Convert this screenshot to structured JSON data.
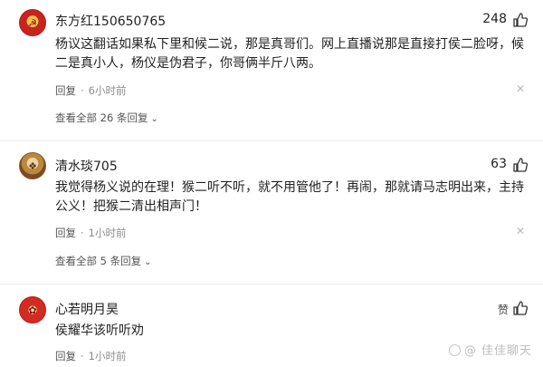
{
  "comments": [
    {
      "username": "东方红150650765",
      "likes": "248",
      "content": "杨议这翻话如果私下里和候二说，那是真哥们。网上直播说那是直接打侯二脸呀，候二是真小人，杨仪是伪君子，你哥俩半斤八两。",
      "reply_label": "回复",
      "time": "6小时前",
      "view_replies": "查看全部 26 条回复"
    },
    {
      "username": "清水琰705",
      "likes": "63",
      "content": "我觉得杨义说的在理！猴二听不听，就不用管他了！再闹，那就请马志明出来，主持公义！把猴二清出相声门！",
      "reply_label": "回复",
      "time": "1小时前",
      "view_replies": "查看全部 5 条回复"
    },
    {
      "username": "心若明月昊",
      "likes": "赞",
      "content": "侯耀华该听听劝",
      "reply_label": "回复",
      "time": "1小时前"
    }
  ],
  "watermark": "@ 佳佳聊天",
  "icons": {
    "like": "thumbs-up-icon",
    "close": "close-icon",
    "expand": "chevron-down-icon"
  },
  "colors": {
    "text": "#222222",
    "meta": "#8a8a8a",
    "divider": "#ececec"
  }
}
